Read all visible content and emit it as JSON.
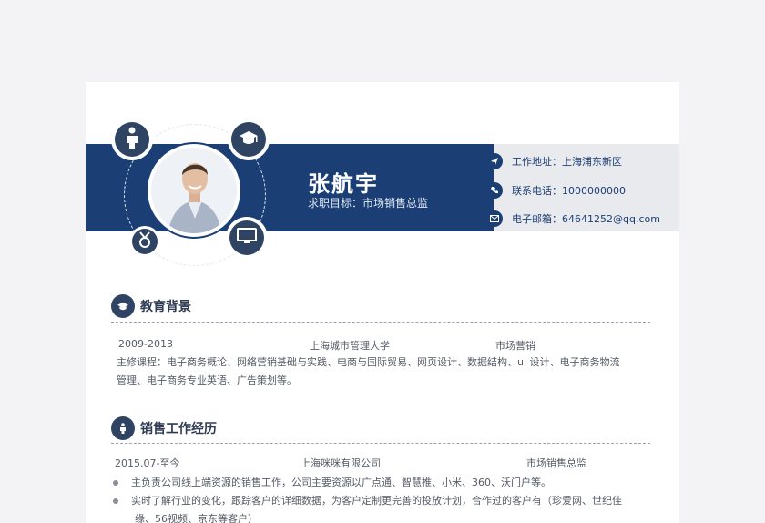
{
  "name": "张航宇",
  "goal": "求职目标：市场销售总监",
  "contact": {
    "address_label": "工作地址：",
    "address": "上海浦东新区",
    "phone_label": "联系电话：",
    "phone": "1000000000",
    "email_label": "电子邮箱：",
    "email": "64641252@qq.com"
  },
  "education": {
    "title": "教育背景",
    "period": "2009-2013",
    "school": "上海城市管理大学",
    "major": "市场营销",
    "courses_line1": "主修课程：电子商务概论、网络营销基础与实践、电商与国际贸易、网页设计、数据结构、ui 设计、电子商务物流",
    "courses_line2": "管理、电子商务专业英语、广告策划等。"
  },
  "work": {
    "title": "销售工作经历",
    "period": "2015.07-至今",
    "company": "上海咪咪有限公司",
    "position": "市场销售总监",
    "bullets": [
      "主负责公司线上端资源的销售工作，公司主要资源以广点通、智慧推、小米、360、沃门户等。",
      "实时了解行业的变化，跟踪客户的详细数据，为客户定制更完善的投放计划，合作过的客户有（珍爱网、世纪佳",
      "缘、56视频、京东等客户）"
    ]
  },
  "icons": [
    "person-icon",
    "graduation-cap-icon",
    "award-icon",
    "monitor-icon",
    "send-icon",
    "phone-icon",
    "mail-icon"
  ],
  "colors": {
    "band": "#1b3f74",
    "gray_band": "#e9eaee",
    "icon_dark": "#2f4363"
  }
}
